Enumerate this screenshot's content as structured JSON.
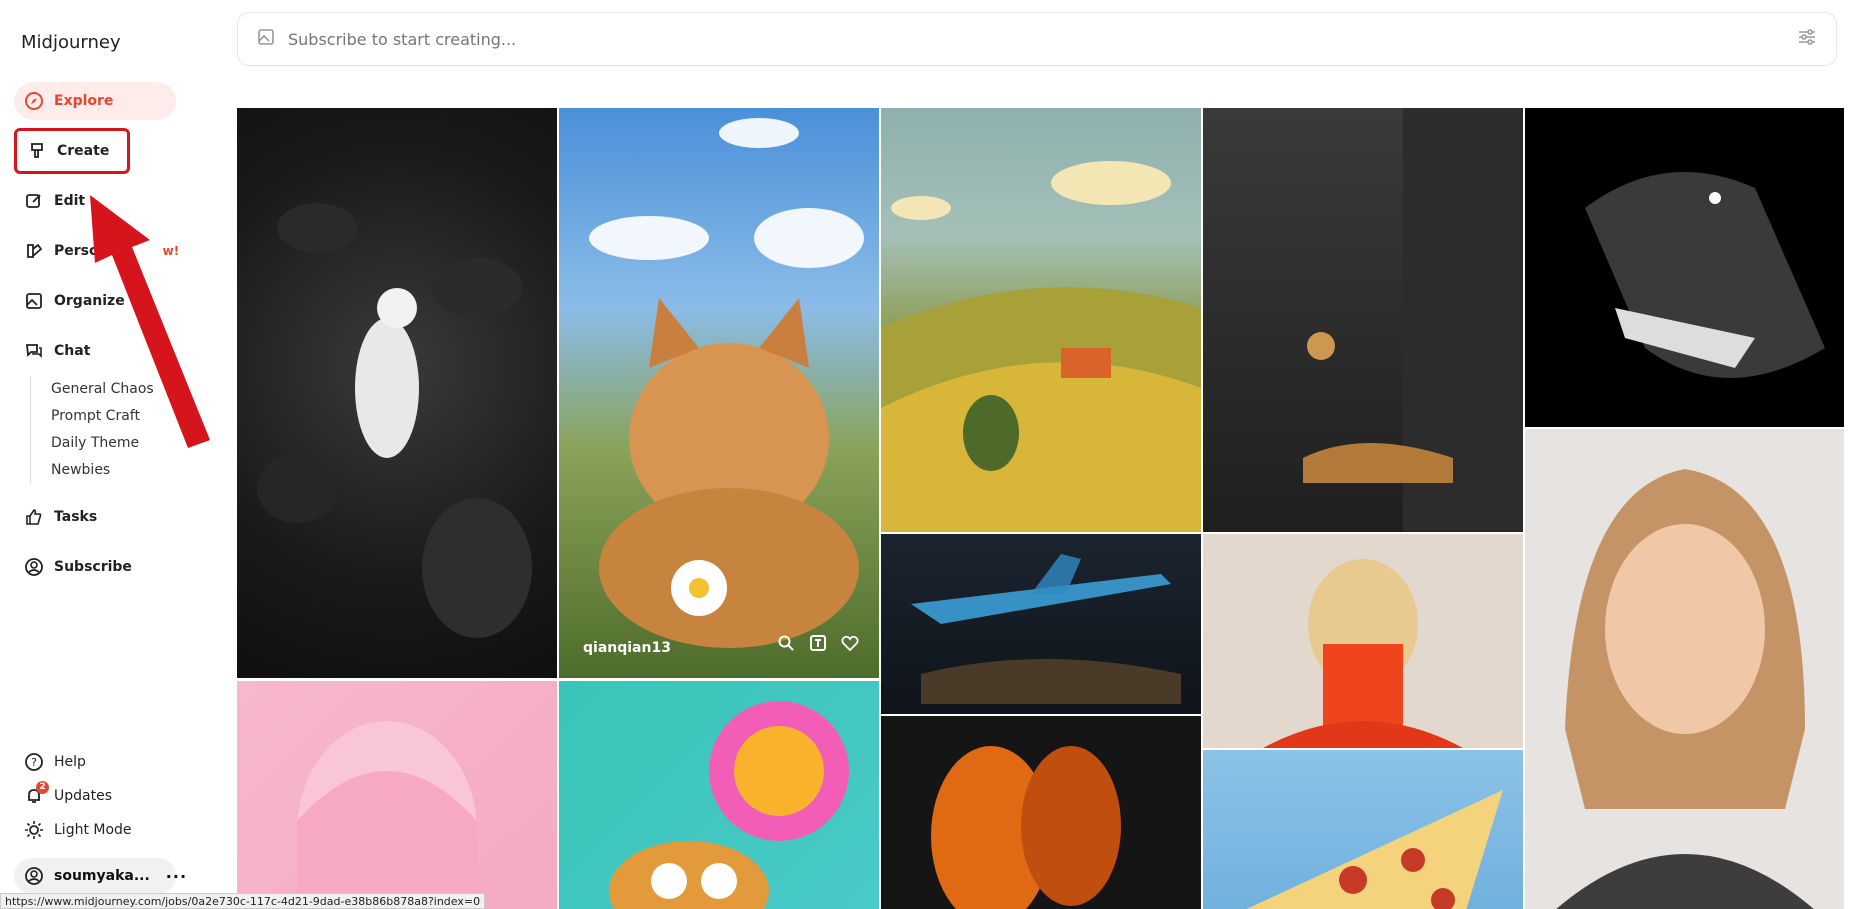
{
  "app": {
    "logo_text": "Midjourney"
  },
  "sidebar": {
    "items": [
      {
        "label": "Explore",
        "icon": "compass-icon"
      },
      {
        "label": "Create",
        "icon": "brush-icon"
      },
      {
        "label": "Edit",
        "icon": "edit-icon"
      },
      {
        "label": "Perso",
        "icon": "palette-icon",
        "badge": "w!"
      },
      {
        "label": "Organize",
        "icon": "image-icon"
      },
      {
        "label": "Chat",
        "icon": "chat-icon"
      }
    ],
    "chat_channels": [
      "General Chaos",
      "Prompt Craft",
      "Daily Theme",
      "Newbies"
    ],
    "items_after": [
      {
        "label": "Tasks",
        "icon": "thumbs-up-icon"
      },
      {
        "label": "Subscribe",
        "icon": "user-circle-icon"
      }
    ],
    "bottom": [
      {
        "label": "Help",
        "icon": "help-icon"
      },
      {
        "label": "Updates",
        "icon": "bell-icon",
        "count": "2"
      },
      {
        "label": "Light Mode",
        "icon": "sun-icon"
      }
    ],
    "user": {
      "name": "soumyaka...",
      "more": "···"
    }
  },
  "search": {
    "placeholder": "Subscribe to start creating..."
  },
  "tiles": [
    {
      "caption": "qianqian13"
    }
  ],
  "statusbar": {
    "url": "https://www.midjourney.com/jobs/0a2e730c-117c-4d21-9dad-e38b86b878a8?index=0"
  },
  "colors": {
    "accent": "#e8472f",
    "annotation": "#d6141c"
  }
}
